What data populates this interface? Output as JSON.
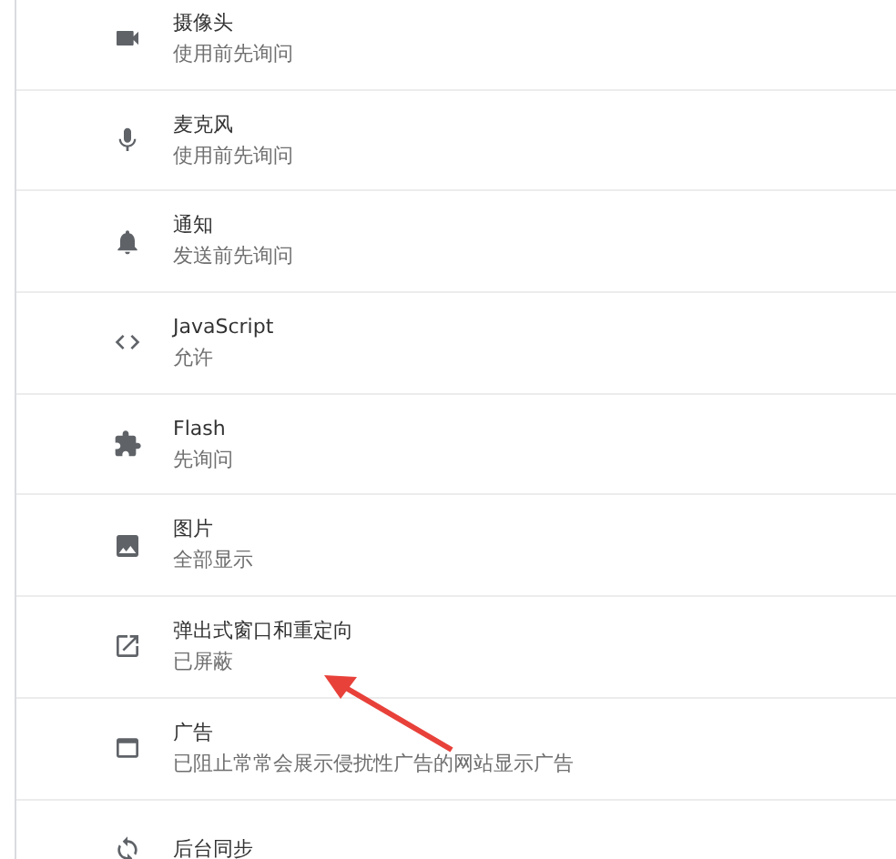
{
  "settings": [
    {
      "kind": "camera",
      "title": "摄像头",
      "subtitle": "使用前先询问"
    },
    {
      "kind": "mic",
      "title": "麦克风",
      "subtitle": "使用前先询问"
    },
    {
      "kind": "bell",
      "title": "通知",
      "subtitle": "发送前先询问"
    },
    {
      "kind": "code",
      "title": "JavaScript",
      "subtitle": "允许"
    },
    {
      "kind": "puzzle",
      "title": "Flash",
      "subtitle": "先询问"
    },
    {
      "kind": "image",
      "title": "图片",
      "subtitle": "全部显示"
    },
    {
      "kind": "external",
      "title": "弹出式窗口和重定向",
      "subtitle": "已屏蔽"
    },
    {
      "kind": "window",
      "title": "广告",
      "subtitle": "已阻止常常会展示侵扰性广告的网站显示广告"
    },
    {
      "kind": "sync",
      "title": "后台同步"
    }
  ]
}
